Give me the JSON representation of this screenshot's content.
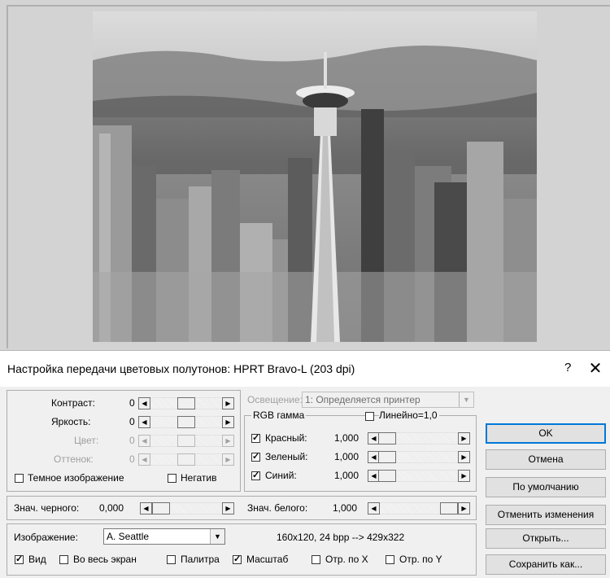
{
  "dialog": {
    "title": "Настройка передачи цветовых полутонов: HPRT Bravo-L (203 dpi)",
    "help_label": "?",
    "close_label": "✕"
  },
  "adjust": {
    "contrast": {
      "label": "Контраст:",
      "value": "0",
      "level": 0.5
    },
    "brightness": {
      "label": "Яркость:",
      "value": "0",
      "level": 0.5
    },
    "color": {
      "label": "Цвет:",
      "value": "0",
      "level": 0.5
    },
    "hue": {
      "label": "Оттенок:",
      "value": "0",
      "level": 0.5
    },
    "dark_image": {
      "label": "Темное изображение",
      "checked": false
    },
    "negative": {
      "label": "Негатив",
      "checked": false
    }
  },
  "illumination": {
    "label": "Освещение:",
    "value": "1: Определяется принтер"
  },
  "rgb_gamma": {
    "title": "RGB гамма",
    "linear": {
      "label": "Линейно=1,0",
      "checked": false
    },
    "red": {
      "label": "Красный:",
      "value": "1,000",
      "checked": true
    },
    "green": {
      "label": "Зеленый:",
      "value": "1,000",
      "checked": true
    },
    "blue": {
      "label": "Синий:",
      "value": "1,000",
      "checked": true
    }
  },
  "levels": {
    "black": {
      "label": "Знач. черного:",
      "value": "0,000",
      "level": 0.0
    },
    "white": {
      "label": "Знач. белого:",
      "value": "1,000",
      "level": 1.0
    }
  },
  "image": {
    "label": "Изображение:",
    "value": "A. Seattle",
    "info": "160x120, 24 bpp  --> 429x322",
    "view": {
      "label": "Вид",
      "checked": true
    },
    "fullscreen": {
      "label": "Во весь экран",
      "checked": false
    },
    "palette": {
      "label": "Палитра",
      "checked": false
    },
    "scale": {
      "label": "Масштаб",
      "checked": true
    },
    "mirror_x": {
      "label": "Отр. по X",
      "checked": false
    },
    "mirror_y": {
      "label": "Отр. по Y",
      "checked": false
    }
  },
  "buttons": {
    "ok": "OK",
    "cancel": "Отмена",
    "default": "По умолчанию",
    "revert": "Отменить изменения",
    "open": "Открыть...",
    "save_as": "Сохранить как..."
  },
  "colors": {
    "accent": "#0078d7",
    "dialog_bg": "#f0f0f0",
    "title_bg": "#ffffff"
  }
}
